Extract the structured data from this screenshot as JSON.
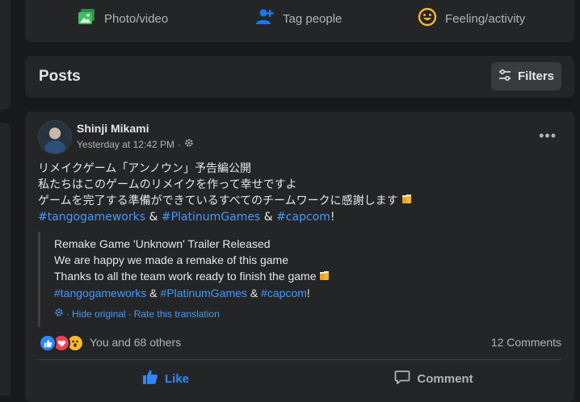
{
  "composer": {
    "photo_label": "Photo/video",
    "tag_label": "Tag people",
    "feeling_label": "Feeling/activity"
  },
  "posts_header": {
    "title": "Posts",
    "filters_label": "Filters"
  },
  "post": {
    "author": "Shinji Mikami",
    "timestamp": "Yesterday at 12:42 PM",
    "separator": "·",
    "original_lines": [
      "リメイクゲーム「アンノウン」予告編公開",
      "私たちはこのゲームのリメイクを作って幸せですよ",
      "ゲームを完了する準備ができているすべてのチームワークに感謝します"
    ],
    "hashtags": [
      "#tangogameworks",
      "#PlatinumGames",
      "#capcom"
    ],
    "ampersand": "&",
    "exclamation": "!",
    "translation_lines": [
      "Remake Game 'Unknown' Trailer Released",
      "We are happy we made a remake of this game",
      "Thanks to all the team work ready to finish the game"
    ],
    "hide_original": "Hide original",
    "rate_translation": "Rate this translation",
    "reactions_text": "You and 68 others",
    "comments_text": "12 Comments",
    "like_label": "Like",
    "comment_label": "Comment"
  },
  "colors": {
    "background": "#18191a",
    "card": "#242526",
    "link": "#4599ff",
    "like_blue": "#2d88ff",
    "photo_green": "#45bd62",
    "tag_blue": "#1877f2",
    "feeling_yellow": "#f7b928"
  }
}
